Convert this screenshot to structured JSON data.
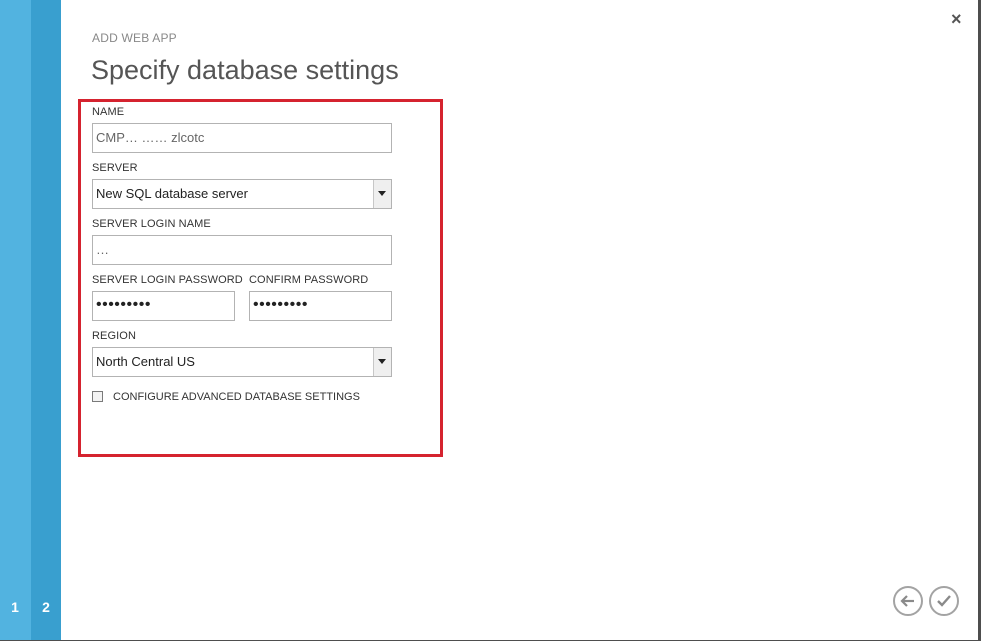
{
  "wizard": {
    "steps": [
      "1",
      "2"
    ],
    "close_glyph": "×",
    "breadcrumb": "ADD WEB APP",
    "title": "Specify database settings"
  },
  "form": {
    "name_label": "NAME",
    "name_value": "CMP… …… zlcotc",
    "server_label": "SERVER",
    "server_value": "New SQL database server",
    "login_label": "SERVER LOGIN NAME",
    "login_value": "…",
    "password_label": "SERVER LOGIN PASSWORD",
    "password_value": "•••••••••",
    "confirm_label": "CONFIRM PASSWORD",
    "confirm_value": "•••••••••",
    "region_label": "REGION",
    "region_value": "North Central US",
    "advanced_label": "CONFIGURE ADVANCED DATABASE SETTINGS",
    "advanced_checked": false
  },
  "nav": {
    "back_icon": "arrow-left-icon",
    "finish_icon": "checkmark-icon"
  },
  "colors": {
    "rail_light": "#52b3e0",
    "rail_dark": "#399fcf",
    "highlight": "#d5232f"
  }
}
